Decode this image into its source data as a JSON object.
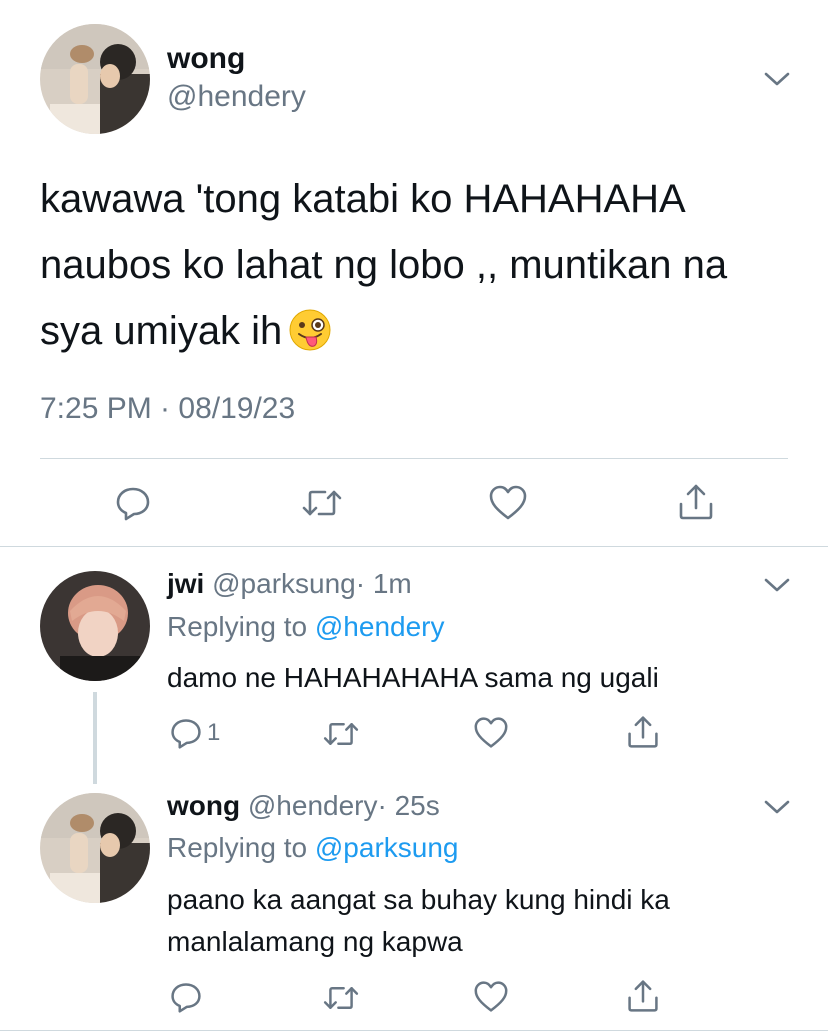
{
  "main_tweet": {
    "author_name": "wong",
    "author_handle": "@hendery",
    "text_lines": [
      "kawawa 'tong katabi ko HAHAHAHA",
      "naubos ko lahat ng lobo ,, muntikan na",
      "sya umiyak ih"
    ],
    "emoji": "winking-face-with-tongue",
    "timestamp": "7:25 PM · 08/19/23"
  },
  "replies": [
    {
      "author_name": "jwi",
      "author_handle": "@parksung",
      "time": "· 1m",
      "replying_prefix": "Replying to",
      "replying_to": "@hendery",
      "text": "damo ne HAHAHAHAHA sama ng ugali",
      "reply_count": "1"
    },
    {
      "author_name": "wong",
      "author_handle": "@hendery",
      "time": "· 25s",
      "replying_prefix": "Replying to",
      "replying_to": "@parksung",
      "text_lines": [
        "paano ka aangat sa buhay kung hindi ka",
        "manlalamang ng kapwa"
      ]
    }
  ],
  "colors": {
    "text": "#0f1419",
    "secondary": "#687684",
    "mention": "#1d9bf0",
    "divider": "#cfd9de"
  }
}
